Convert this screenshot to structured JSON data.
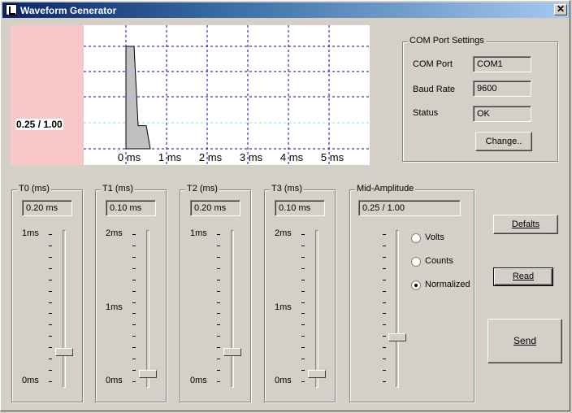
{
  "window": {
    "title": "Waveform Generator",
    "close_glyph": "✕"
  },
  "plot": {
    "amplitude_label": "0.25 / 1.00",
    "x_ticks": [
      "0 ms",
      "1 ms",
      "2 ms",
      "3 ms",
      "4 ms",
      "5 ms"
    ],
    "colors": {
      "left_band": "#f8c8c8",
      "grid": "#0000c0",
      "waveform": "#c0c0c0",
      "midline": "#80e0e0"
    },
    "waveform": {
      "T0_ms": 0.2,
      "T1_ms": 0.1,
      "T2_ms": 0.2,
      "T3_ms": 0.1,
      "amplitude": 0.25
    }
  },
  "com": {
    "title": "COM Port Settings",
    "port_label": "COM Port",
    "port_value": "COM1",
    "baud_label": "Baud Rate",
    "baud_value": "9600",
    "status_label": "Status",
    "status_value": "OK",
    "change_button": "Change.."
  },
  "sliders": [
    {
      "label": "T0 (ms)",
      "value": "0.20 ms",
      "top": "1ms",
      "mid": "",
      "bottom": "0ms",
      "fraction": 0.2
    },
    {
      "label": "T1 (ms)",
      "value": "0.10 ms",
      "top": "2ms",
      "mid": "1ms",
      "bottom": "0ms",
      "fraction": 0.05
    },
    {
      "label": "T2 (ms)",
      "value": "0.20 ms",
      "top": "1ms",
      "mid": "",
      "bottom": "0ms",
      "fraction": 0.2
    },
    {
      "label": "T3 (ms)",
      "value": "0.10 ms",
      "top": "2ms",
      "mid": "1ms",
      "bottom": "0ms",
      "fraction": 0.05
    }
  ],
  "mid_amplitude": {
    "label": "Mid-Amplitude",
    "value": "0.25 / 1.00",
    "fraction": 0.25,
    "options": [
      {
        "label": "Volts",
        "checked": false
      },
      {
        "label": "Counts",
        "checked": false
      },
      {
        "label": "Normalized",
        "checked": true
      }
    ]
  },
  "buttons": {
    "defaults": "Defalts",
    "read": "Read",
    "send": "Send"
  }
}
